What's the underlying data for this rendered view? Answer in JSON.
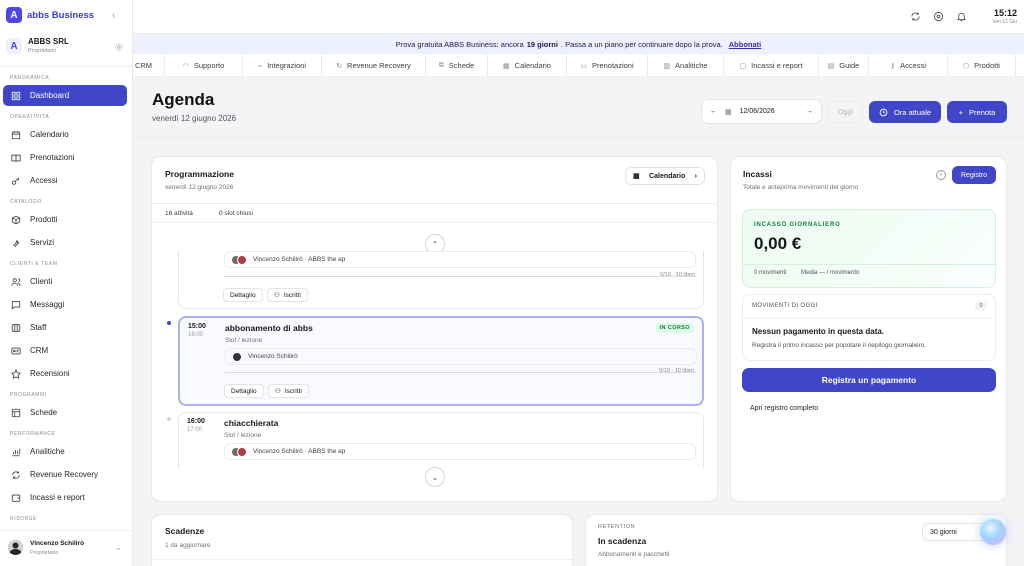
{
  "brand": {
    "name": "abbs Business"
  },
  "org": {
    "name": "ABBS SRL",
    "role": "Proprietario"
  },
  "sidebar": {
    "sections": [
      {
        "label": "Panoramica"
      },
      {
        "label": "Operatività"
      },
      {
        "label": "Catalogo"
      },
      {
        "label": "Clienti e team"
      },
      {
        "label": "Programmi"
      },
      {
        "label": "Performance"
      },
      {
        "label": "Risorse"
      }
    ],
    "items": [
      {
        "label": "Dashboard",
        "icon": "grid-icon"
      },
      {
        "label": "Calendario",
        "icon": "calendar-icon"
      },
      {
        "label": "Prenotazioni",
        "icon": "book-icon"
      },
      {
        "label": "Accessi",
        "icon": "key-icon"
      },
      {
        "label": "Prodotti",
        "icon": "box-icon"
      },
      {
        "label": "Servizi",
        "icon": "wrench-icon"
      },
      {
        "label": "Clienti",
        "icon": "users-icon"
      },
      {
        "label": "Messaggi",
        "icon": "message-icon"
      },
      {
        "label": "Staff",
        "icon": "staff-icon"
      },
      {
        "label": "CRM",
        "icon": "id-card-icon"
      },
      {
        "label": "Recensioni",
        "icon": "star-icon"
      },
      {
        "label": "Schede",
        "icon": "layers-icon"
      },
      {
        "label": "Analitiche",
        "icon": "chart-icon"
      },
      {
        "label": "Revenue Recovery",
        "icon": "refresh-icon"
      },
      {
        "label": "Incassi e report",
        "icon": "wallet-icon"
      }
    ]
  },
  "user": {
    "name": "Vincenzo Schilirò",
    "role": "Proprietario"
  },
  "clock": {
    "time": "15:12",
    "date": "Ven 12 Giu"
  },
  "banner": {
    "prefix": "Prova gratuita ABBS Business: ancora",
    "days": "19 giorni",
    "suffix": ". Passa a un piano per continuare dopo la prova.",
    "link": "Abbonati"
  },
  "tabs": [
    "CRM",
    "Supporto",
    "Integrazioni",
    "Revenue Recovery",
    "Schede",
    "Calendario",
    "Prenotazioni",
    "Analitiche",
    "Incassi e report",
    "Guide",
    "Accessi",
    "Prodotti"
  ],
  "page": {
    "title": "Agenda",
    "subtitle": "venerdì 12 giugno 2026"
  },
  "date_input": {
    "value": "12/06/2026"
  },
  "actions": {
    "today": "Oggi",
    "now": "Ora attuale",
    "book": "Prenota"
  },
  "schedule": {
    "title": "Programmazione",
    "date": "venerdì 12 giugno 2026",
    "calendar_btn": "Calendario",
    "activities": "16 attività",
    "closed": "0 slot chiusi",
    "events": [
      {
        "start": "",
        "end": "",
        "title": "",
        "type": "",
        "attendees": "Vincenzo Schilirò · ABBS the ap",
        "capacity": "0/10 · 10 liberi",
        "detail": "Dettaglio",
        "enrolled": "Iscritti"
      },
      {
        "start": "15:00",
        "end": "16:00",
        "title": "abbonamento di abbs",
        "type": "Slot / lezione",
        "badge": "IN CORSO",
        "attendees": "Vincenzo Schilirò",
        "capacity": "0/10 · 10 liberi",
        "detail": "Dettaglio",
        "enrolled": "Iscritti"
      },
      {
        "start": "16:00",
        "end": "17:00",
        "title": "chiacchierata",
        "type": "Slot / lezione",
        "attendees": "Vincenzo Schilirò · ABBS the ap"
      }
    ]
  },
  "incassi": {
    "title": "Incassi",
    "subtitle": "Totale e anteprima movimenti del giorno",
    "register_btn": "Registro",
    "daily_label": "INCASSO GIORNALIERO",
    "daily_value": "0,00 €",
    "movements_count": "0 movimenti",
    "average": "Media — / movimento",
    "today_header": "MOVIMENTI DI OGGI",
    "today_count": "0",
    "empty_title": "Nessun pagamento in questa data.",
    "empty_hint": "Registra il primo incasso per popolare il riepilogo giornaliero.",
    "pay_btn": "Registra un pagamento",
    "open_register": "Apri registro completo"
  },
  "deadlines": {
    "title": "Scadenze",
    "subtitle": "1 da aggiornare"
  },
  "retention": {
    "eyebrow": "RETENTION",
    "title": "In scadenza",
    "subtitle": "Abbonamenti e pacchetti",
    "range": "30 giorni"
  }
}
